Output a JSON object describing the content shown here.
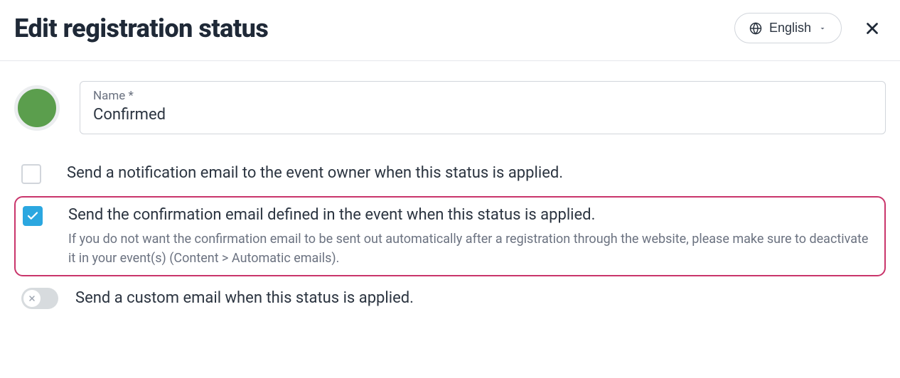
{
  "header": {
    "title": "Edit registration status",
    "language_label": "English"
  },
  "form": {
    "name_label": "Name *",
    "name_value": "Confirmed",
    "status_color": "#5b9e4d"
  },
  "options": {
    "notify_owner": {
      "label": "Send a notification email to the event owner when this status is applied.",
      "checked": false
    },
    "confirmation_email": {
      "label": "Send the confirmation email defined in the event when this status is applied.",
      "description": "If you do not want the confirmation email to be sent out automatically after a registration through the website, please make sure to deactivate it in your event(s) (Content > Automatic emails).",
      "checked": true
    },
    "custom_email": {
      "label": "Send a custom email when this status is applied.",
      "enabled": false
    }
  }
}
